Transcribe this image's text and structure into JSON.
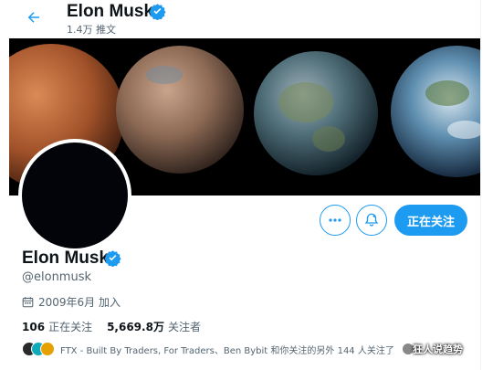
{
  "header": {
    "name": "Elon Musk",
    "tweet_count": "1.4万 推文"
  },
  "profile": {
    "name": "Elon Musk",
    "handle": "@elonmusk",
    "joined": "2009年6月 加入",
    "following_count": "106",
    "following_label": "正在关注",
    "followers_count": "5,669.8万",
    "followers_label": "关注者",
    "followed_by_text": "FTX - Built By Traders, For Traders、Ben Bybit 和你关注的另外 144 人关注了",
    "watermark": "狂人说趋势"
  },
  "actions": {
    "more_label": "···",
    "follow_label": "正在关注"
  },
  "colors": {
    "accent": "#1d9bf0",
    "text_primary": "#0f1419",
    "text_secondary": "#536471",
    "verified": "#1d9bf0"
  },
  "icons": [
    "back-arrow-icon",
    "verified-badge-icon",
    "more-icon",
    "notification-bell-icon",
    "calendar-icon"
  ]
}
